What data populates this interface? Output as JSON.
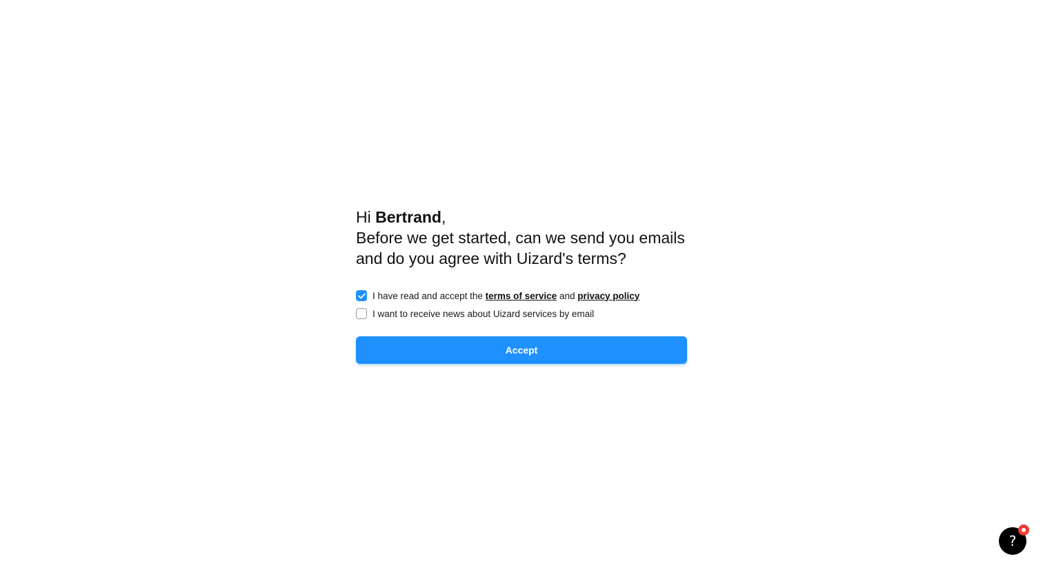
{
  "greeting": {
    "prefix": "Hi ",
    "name": "Bertrand",
    "suffix": ",",
    "line2": "Before we get started, can we send you emails",
    "line3": "and do you agree with Uizard's terms?"
  },
  "terms_option": {
    "checked": true,
    "text_before": "I have read and accept the ",
    "terms_link": "terms of service",
    "text_middle": " and ",
    "privacy_link": "privacy policy"
  },
  "news_option": {
    "checked": false,
    "text": "I want to receive news about Uizard services by email"
  },
  "accept_button": {
    "label": "Accept"
  },
  "help": {
    "icon": "question-mark-icon",
    "symbol": "?",
    "has_notification": true
  },
  "colors": {
    "accent": "#1e90ff",
    "notification": "#ef3e36",
    "help_bg": "#000000"
  }
}
